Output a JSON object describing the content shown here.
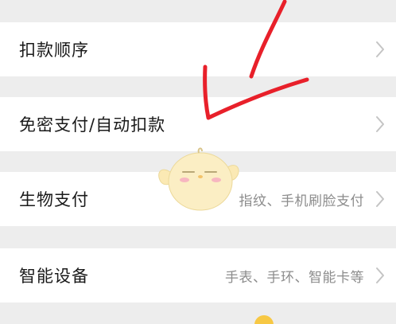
{
  "settings": {
    "items": [
      {
        "label": "扣款顺序",
        "value": ""
      },
      {
        "label": "免密支付/自动扣款",
        "value": ""
      },
      {
        "label": "生物支付",
        "value": "指纹、手机刷脸支付"
      },
      {
        "label": "智能设备",
        "value": "手表、手环、智能卡等"
      }
    ]
  },
  "colors": {
    "background": "#ededed",
    "row": "#ffffff",
    "label": "#1a1a1a",
    "value": "#8c8c8c",
    "chevron": "#c4c4c4",
    "annotation": "#e8202a",
    "mascot": "#fbe9b4"
  },
  "icons": {
    "chevron": "chevron-right-icon",
    "annotation": "red-hand-drawn-arrow",
    "sticker": "yellow-chick-sticker"
  }
}
